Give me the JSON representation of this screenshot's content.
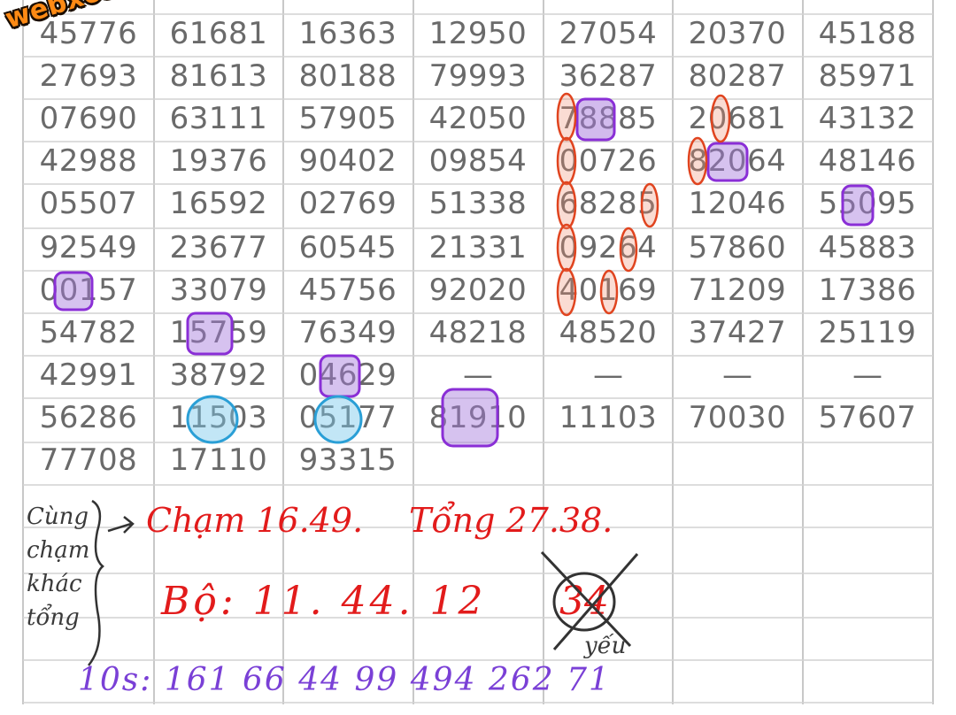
{
  "watermark": "webxoso.net",
  "table_rows": [
    [
      "45776",
      "61681",
      "16363",
      "12950",
      "27054",
      "20370",
      "45188"
    ],
    [
      "27693",
      "81613",
      "80188",
      "79993",
      "36287",
      "80287",
      "85971"
    ],
    [
      "07690",
      "63111",
      "57905",
      "42050",
      "78885",
      "20681",
      "43132"
    ],
    [
      "42988",
      "19376",
      "90402",
      "09854",
      "00726",
      "82064",
      "48146"
    ],
    [
      "05507",
      "16592",
      "02769",
      "51338",
      "68285",
      "12046",
      "55095"
    ],
    [
      "92549",
      "23677",
      "60545",
      "21331",
      "09264",
      "57860",
      "45883"
    ],
    [
      "00157",
      "33079",
      "45756",
      "92020",
      "40169",
      "71209",
      "17386"
    ],
    [
      "54782",
      "15759",
      "76349",
      "48218",
      "48520",
      "37427",
      "25119"
    ],
    [
      "42991",
      "38792",
      "04629",
      "—",
      "—",
      "—",
      "—"
    ],
    [
      "56286",
      "11503",
      "05177",
      "81910",
      "11103",
      "70030",
      "57607"
    ],
    [
      "77708",
      "17110",
      "93315",
      "",
      "",
      "",
      ""
    ]
  ],
  "notes": {
    "side_label": [
      "Cùng",
      "chạm",
      "khác",
      "tổng"
    ],
    "cham": "Chạm 16.49.",
    "tong": "Tổng 27.38.",
    "bo": "Bộ: 11. 44. 12",
    "crossed": "34",
    "yeu": "yếu",
    "loto": "10s: 161 66 44 99 494 262 71"
  }
}
